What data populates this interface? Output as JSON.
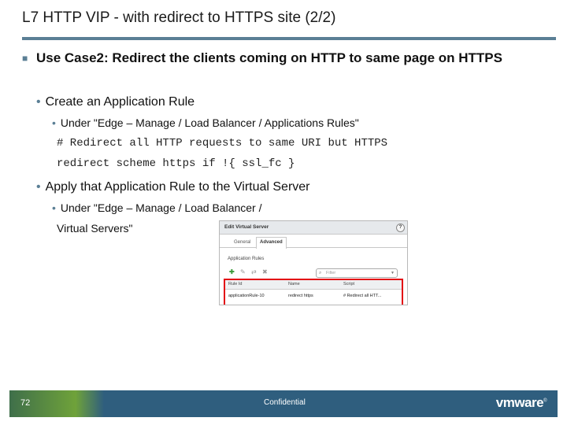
{
  "slide": {
    "title": "L7 HTTP VIP - with redirect to HTTPS site (2/2)",
    "bullet1": "Use Case2: Redirect the clients coming on HTTP to same page on HTTPS",
    "sub1": "Create an Application Rule",
    "sub1_detail": "Under \"Edge – Manage /  Load Balancer / Applications Rules\"",
    "code_line1": "# Redirect all HTTP requests to same URI but HTTPS",
    "code_line2": "redirect scheme https if !{ ssl_fc }",
    "sub2": "Apply that Application Rule to the Virtual Server",
    "sub2_detail_a": "Under \"Edge – Manage /  Load Balancer /",
    "sub2_detail_b": "Virtual Servers\""
  },
  "dialog": {
    "title": "Edit Virtual Server",
    "help": "?",
    "tabs": [
      "General",
      "Advanced"
    ],
    "active_tab": "Advanced",
    "section": "Application Rules",
    "filter_placeholder": "Filter",
    "columns": [
      "Rule Id",
      "Name",
      "Script"
    ],
    "rows": [
      [
        "applicationRule-10",
        "redirect https",
        "# Redirect all HTT..."
      ]
    ],
    "highlight_color": "#e30613"
  },
  "footer": {
    "page_number": "72",
    "label": "Confidential",
    "logo": "vmware"
  },
  "colors": {
    "accent": "#5b7f95",
    "footer_bg": "#2f5e7e",
    "footer_green": "#6fa23a"
  }
}
